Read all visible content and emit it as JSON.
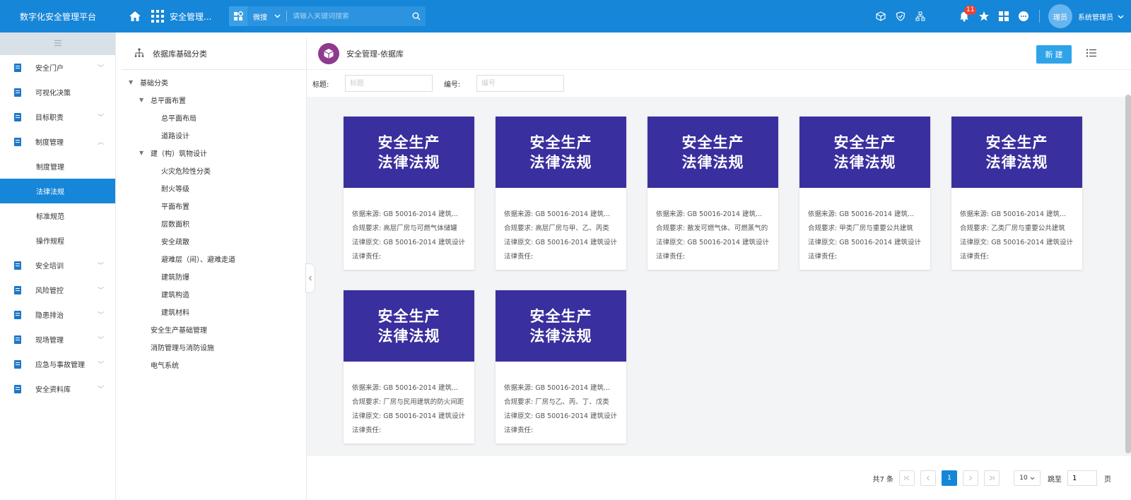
{
  "topbar": {
    "brand": "数字化安全管理平台",
    "system_name": "安全管理...",
    "search_scope": "微搜",
    "search_placeholder": "请输入关键词搜索",
    "notification_count": "11",
    "avatar_text": "理员",
    "user_name": "系统管理员"
  },
  "sidebar": {
    "items": [
      {
        "label": "安全门户",
        "chevron": "﹀"
      },
      {
        "label": "可视化决策",
        "chevron": ""
      },
      {
        "label": "目标职责",
        "chevron": "﹀"
      },
      {
        "label": "制度管理",
        "chevron": "︿"
      },
      {
        "label": "安全培训",
        "chevron": "﹀"
      },
      {
        "label": "风险管控",
        "chevron": "﹀"
      },
      {
        "label": "隐患排治",
        "chevron": "﹀"
      },
      {
        "label": "现场管理",
        "chevron": "﹀"
      },
      {
        "label": "应急与事故管理",
        "chevron": "﹀"
      },
      {
        "label": "安全资料库",
        "chevron": "﹀"
      }
    ],
    "sub_items": [
      "制度管理",
      "法律法规",
      "标准规范",
      "操作规程"
    ]
  },
  "tree": {
    "title": "依据库基础分类",
    "nodes": [
      {
        "label": "基础分类",
        "arrow": "▼"
      },
      {
        "label": "总平面布置",
        "arrow": "▼"
      },
      {
        "label": "总平面布局",
        "arrow": ""
      },
      {
        "label": "道路设计",
        "arrow": ""
      },
      {
        "label": "建（构）筑物设计",
        "arrow": "▼"
      },
      {
        "label": "火灾危险性分类",
        "arrow": ""
      },
      {
        "label": "耐火等级",
        "arrow": ""
      },
      {
        "label": "平面布置",
        "arrow": ""
      },
      {
        "label": "层数面积",
        "arrow": ""
      },
      {
        "label": "安全疏散",
        "arrow": ""
      },
      {
        "label": "避难层（间）、避难走道",
        "arrow": ""
      },
      {
        "label": "建筑防爆",
        "arrow": ""
      },
      {
        "label": "建筑构造",
        "arrow": ""
      },
      {
        "label": "建筑材料",
        "arrow": ""
      },
      {
        "label": "安全生产基础管理",
        "arrow": ""
      },
      {
        "label": "消防管理与消防设施",
        "arrow": ""
      },
      {
        "label": "电气系统",
        "arrow": ""
      }
    ]
  },
  "content": {
    "title": "安全管理-依据库",
    "new_button": "新 建",
    "filter_title_label": "标题:",
    "filter_title_placeholder": "标题",
    "filter_code_label": "编号:",
    "filter_code_placeholder": "编号",
    "cards": [
      {
        "banner_line1": "安全生产",
        "banner_line2": "法律法规",
        "source": "依据来源:  GB 50016-2014 建筑...",
        "requirement": "合规要求:  高层厂房与可燃气体储罐",
        "original": "法律原文:  GB 50016-2014 建筑设计",
        "liability": "法律责任:"
      },
      {
        "banner_line1": "安全生产",
        "banner_line2": "法律法规",
        "source": "依据来源:  GB 50016-2014 建筑...",
        "requirement": "合规要求:  高层厂房与甲、乙、丙类",
        "original": "法律原文:  GB 50016-2014 建筑设计",
        "liability": "法律责任:"
      },
      {
        "banner_line1": "安全生产",
        "banner_line2": "法律法规",
        "source": "依据来源:  GB 50016-2014 建筑...",
        "requirement": "合规要求:  散发可燃气体、可燃蒸气的",
        "original": "法律原文:  GB 50016-2014 建筑设计",
        "liability": "法律责任:"
      },
      {
        "banner_line1": "安全生产",
        "banner_line2": "法律法规",
        "source": "依据来源:  GB 50016-2014 建筑...",
        "requirement": "合规要求:  甲类厂房与重要公共建筑",
        "original": "法律原文:  GB 50016-2014 建筑设计",
        "liability": "法律责任:"
      },
      {
        "banner_line1": "安全生产",
        "banner_line2": "法律法规",
        "source": "依据来源:  GB 50016-2014 建筑...",
        "requirement": "合规要求:  乙类厂房与重要公共建筑",
        "original": "法律原文:  GB 50016-2014 建筑设计",
        "liability": "法律责任:"
      },
      {
        "banner_line1": "安全生产",
        "banner_line2": "法律法规",
        "source": "依据来源:  GB 50016-2014 建筑...",
        "requirement": "合规要求:  厂房与民用建筑的防火间距",
        "original": "法律原文:  GB 50016-2014 建筑设计",
        "liability": "法律责任:"
      },
      {
        "banner_line1": "安全生产",
        "banner_line2": "法律法规",
        "source": "依据来源:  GB 50016-2014 建筑...",
        "requirement": "合规要求:  厂房与乙、丙、丁、戊类",
        "original": "法律原文:  GB 50016-2014 建筑设计",
        "liability": "法律责任:"
      }
    ]
  },
  "pager": {
    "total": "共7 条",
    "current": "1",
    "page_size": "10",
    "jump_label": "跳至",
    "jump_value": "1",
    "page_suffix": "页"
  },
  "colors": {
    "topbar": "#1686d8",
    "active_nav": "#1686d8",
    "card_banner": "#3a2f9e",
    "new_button": "#2fa3e8",
    "logo": "#8e3a8e",
    "badge": "#f04134"
  }
}
